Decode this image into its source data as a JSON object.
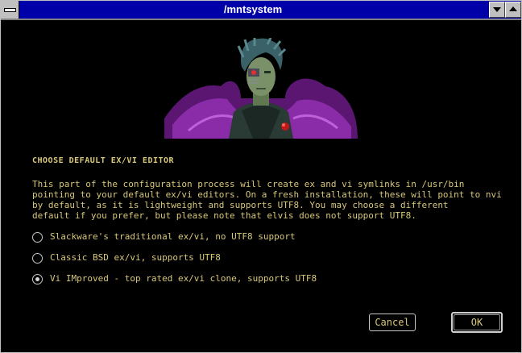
{
  "window": {
    "title": "/mntsystem"
  },
  "dialog": {
    "heading": "CHOOSE DEFAULT EX/VI EDITOR",
    "description_lines": [
      "This part of the configuration process will create ex and vi symlinks in /usr/bin",
      "pointing to your default ex/vi editors. On a fresh installation, these will point to nvi",
      "by default, as it is lightweight and supports UTF8. You may choose a different",
      "default if you prefer, but please note that elvis does not support UTF8."
    ],
    "options": [
      {
        "label": "Slackware's traditional ex/vi, no UTF8 support",
        "selected": false
      },
      {
        "label": "Classic BSD ex/vi, supports UTF8",
        "selected": false
      },
      {
        "label": "Vi IMproved - top rated ex/vi clone, supports UTF8",
        "selected": true
      }
    ]
  },
  "buttons": {
    "cancel": "Cancel",
    "ok": "OK"
  },
  "icons": {
    "system_menu": "system-menu-icon",
    "minimize": "minimize-icon",
    "maximize": "maximize-icon",
    "banner": "cyborg-portrait"
  },
  "colors": {
    "titlebar": "#0000a8",
    "text": "#d8c878",
    "background": "#000000"
  }
}
